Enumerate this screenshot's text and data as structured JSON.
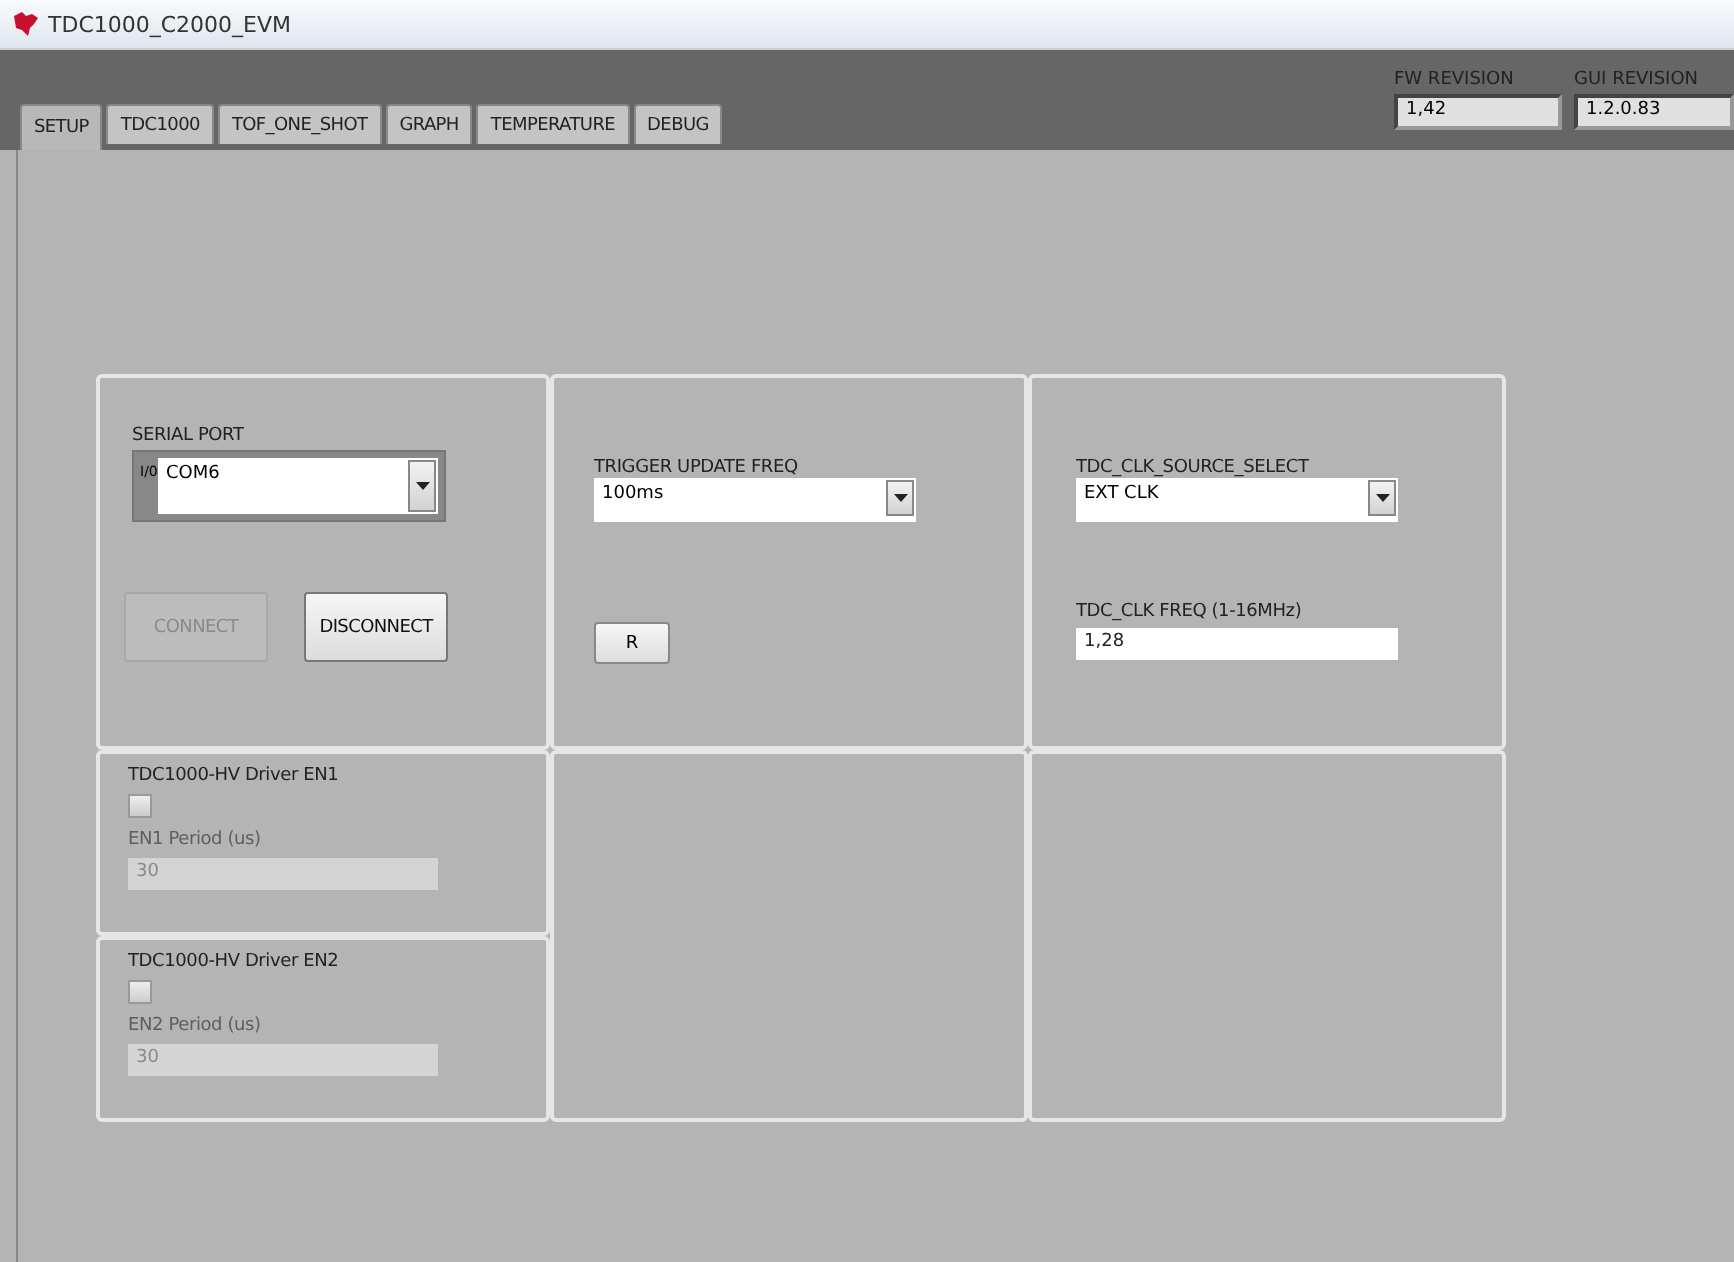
{
  "window": {
    "title": "TDC1000_C2000_EVM"
  },
  "revisions": [
    {
      "label": "FW REVISION",
      "value": "1,42"
    },
    {
      "label": "GUI REVISION",
      "value": "1.2.0.83"
    }
  ],
  "tabs": [
    {
      "label": "SETUP",
      "selected": true
    },
    {
      "label": "TDC1000",
      "selected": false
    },
    {
      "label": "TOF_ONE_SHOT",
      "selected": false
    },
    {
      "label": "GRAPH",
      "selected": false
    },
    {
      "label": "TEMPERATURE",
      "selected": false
    },
    {
      "label": "DEBUG",
      "selected": false
    }
  ],
  "serial": {
    "label": "SERIAL PORT",
    "io": "I/0",
    "value": "COM6"
  },
  "connection_buttons": [
    {
      "label": "CONNECT",
      "disabled": true
    },
    {
      "label": "DISCONNECT",
      "disabled": false
    }
  ],
  "trigger": {
    "label": "TRIGGER UPDATE FREQ",
    "value": "100ms",
    "button": "R"
  },
  "clock": {
    "label": "TDC_CLK_SOURCE_SELECT",
    "value": "EXT CLK",
    "freq_label": "TDC_CLK FREQ (1-16MHz)",
    "freq_value": "1,28"
  },
  "drivers": [
    {
      "label": "TDC1000-HV Driver EN1",
      "checked": false,
      "period_label": "EN1 Period (us)",
      "period_value": "30",
      "disabled": true
    },
    {
      "label": "TDC1000-HV Driver EN2",
      "checked": false,
      "period_label": "EN2 Period (us)",
      "period_value": "30",
      "disabled": true
    }
  ]
}
